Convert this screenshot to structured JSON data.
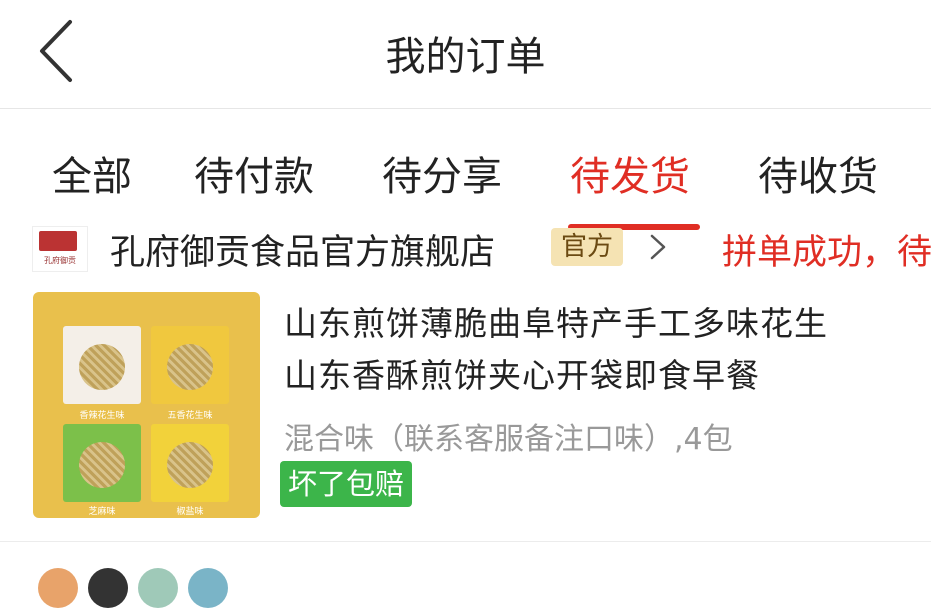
{
  "header": {
    "title": "我的订单",
    "back_icon": "chevron-left-icon"
  },
  "tabs": [
    {
      "label": "全部",
      "active": false
    },
    {
      "label": "待付款",
      "active": false
    },
    {
      "label": "待分享",
      "active": false
    },
    {
      "label": "待发货",
      "active": true
    },
    {
      "label": "待收货",
      "active": false
    }
  ],
  "accent_color": "#e02e24",
  "order": {
    "shop_name": "孔府御贡食品官方旗舰店",
    "shop_tag": "官方",
    "status": "拼单成功，待",
    "product": {
      "title_line1": "山东煎饼薄脆曲阜特产手工多味花生",
      "title_line2": "山东香酥煎饼夹心开袋即食早餐",
      "spec": "混合味（联系客服备注口味）,4包",
      "badge": "坏了包赔",
      "packages": [
        "香辣花生味",
        "五香花生味",
        "芝麻味",
        "椒盐味"
      ],
      "badge_color": "#3cb54a"
    }
  }
}
